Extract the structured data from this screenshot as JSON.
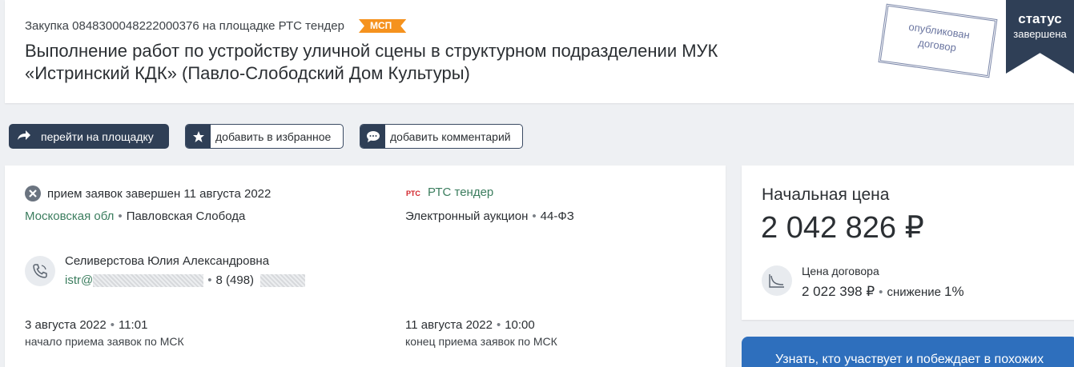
{
  "header": {
    "purchase_label": "Закупка 0848300048222000376 на площадке РТС тендер",
    "msp_badge": "МСП",
    "title_line1": "Выполнение работ по устройству уличной сцены в структурном подразделении МУК",
    "title_line2": "«Истринский КДК» (Павло-Слободский Дом Культуры)",
    "stamp_line1": "опубликован",
    "stamp_line2": "договор",
    "status_title": "статус",
    "status_value": "завершена"
  },
  "actions": {
    "goto_platform": "перейти на площадку",
    "add_favorite": "добавить в избранное",
    "add_comment": "добавить комментарий"
  },
  "info": {
    "status_text": "прием заявок завершен 11 августа 2022",
    "region": "Московская обл",
    "city": "Павловская Слобода",
    "platform_logo": "РТС",
    "platform_name": "РТС тендер",
    "procedure": "Электронный аукцион",
    "law": "44-ФЗ",
    "contact_name": "Селиверстова Юлия Александровна",
    "email_prefix": "istr@",
    "phone_prefix": "8 (498)",
    "start_date": "3 августа 2022",
    "start_time": "11:01",
    "start_label": "начало приема заявок по МСК",
    "end_date": "11 августа 2022",
    "end_time": "10:00",
    "end_label": "конец приема заявок по МСК"
  },
  "price": {
    "initial_label": "Начальная цена",
    "initial_value": "2 042 826 ₽",
    "contract_label": "Цена договора",
    "contract_value": "2 022 398 ₽",
    "decrease_label": "снижение",
    "decrease_value": "1%"
  },
  "cta": {
    "text": "Узнать, кто участвует и побеждает в похожих"
  },
  "colors": {
    "accent_dark": "#2f3f56",
    "badge_orange": "#f5921e",
    "link_green": "#3b7d5e",
    "cta_blue": "#2e6fbd"
  },
  "icons": [
    "share-arrow-icon",
    "star-icon",
    "comment-icon",
    "close-circle-icon",
    "rts-logo-icon",
    "phone-icon",
    "chart-decrease-icon"
  ]
}
